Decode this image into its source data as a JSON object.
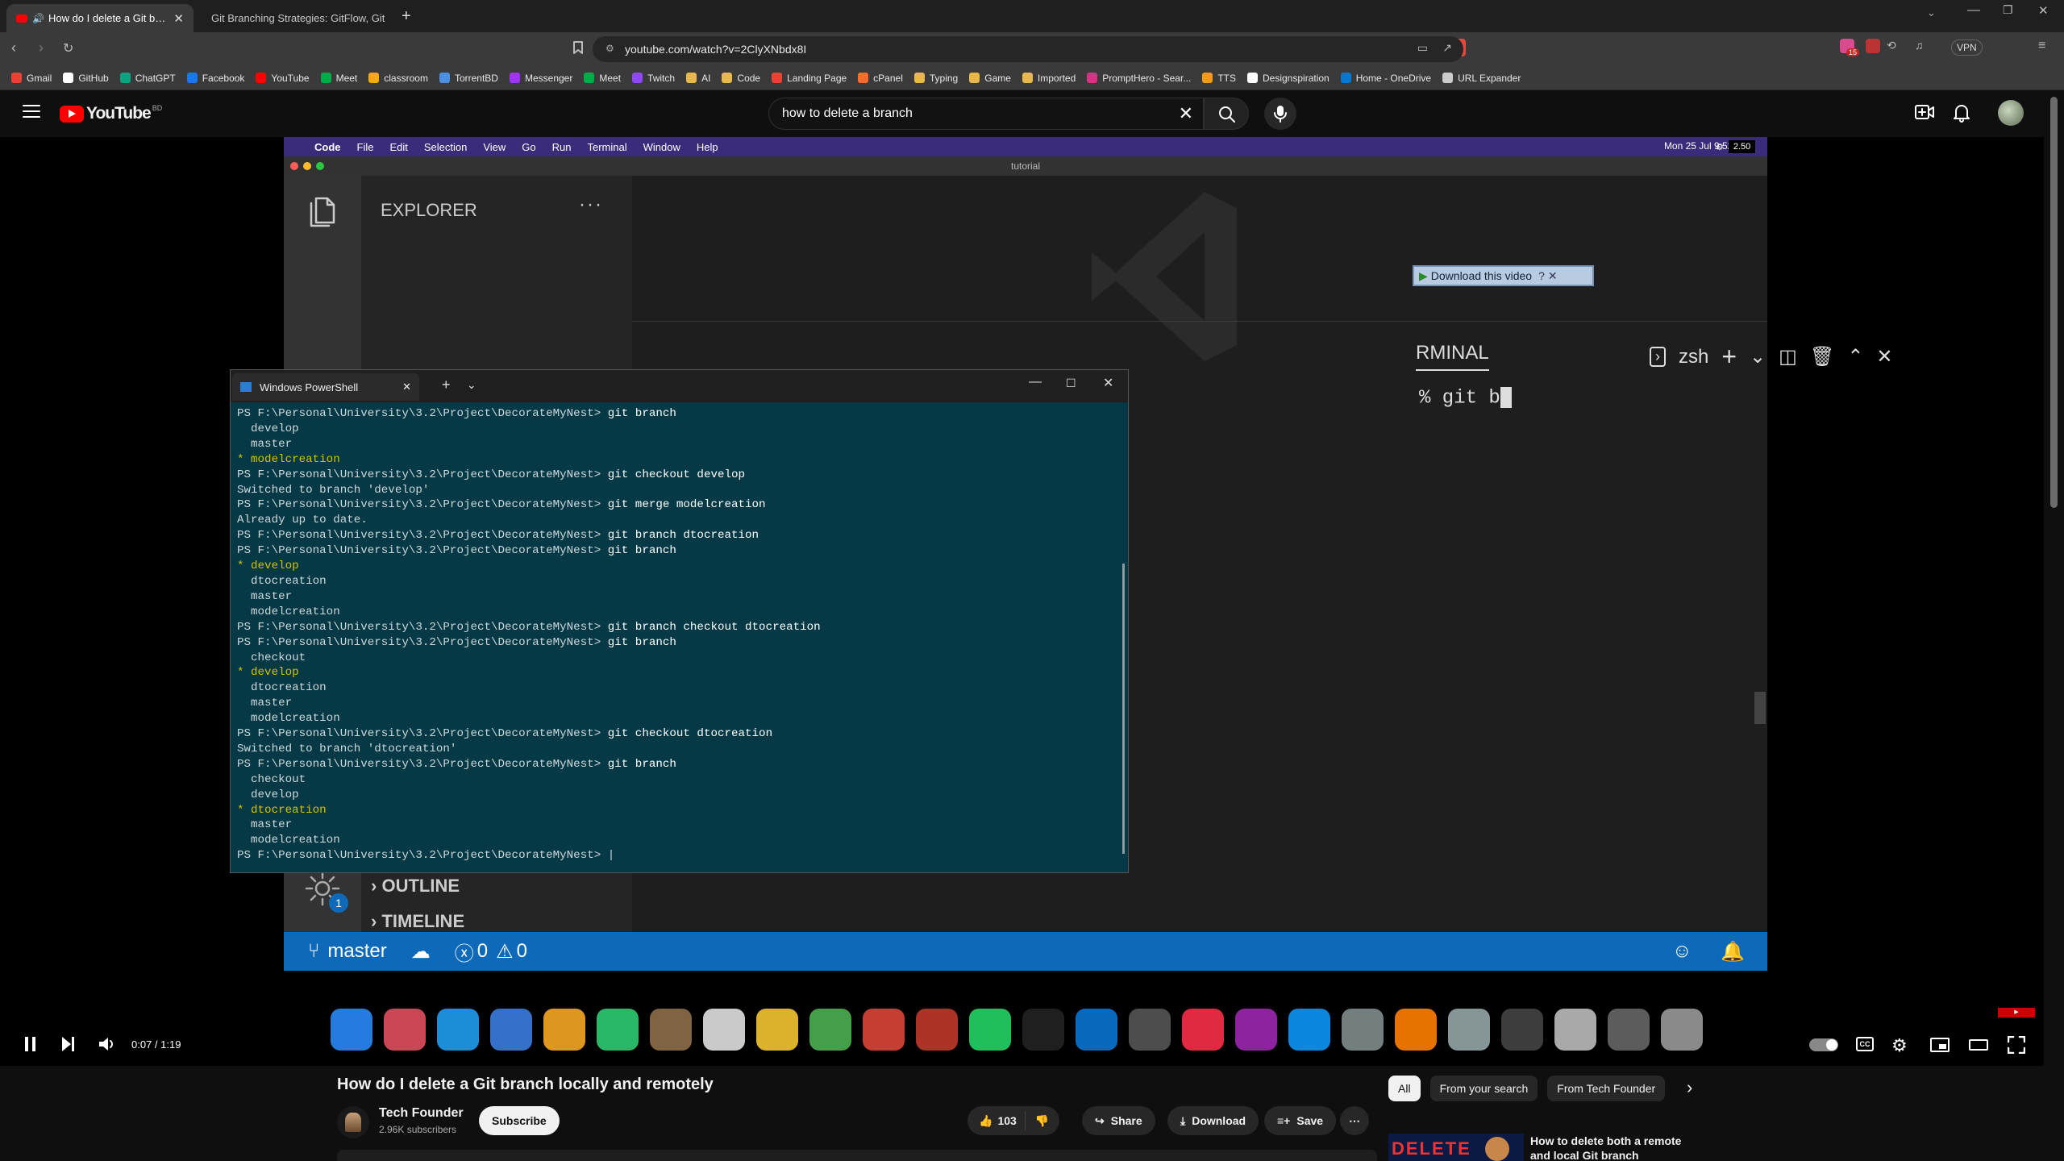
{
  "browser": {
    "tabs": [
      {
        "title": "How do I delete a Git branch"
      },
      {
        "title": "Git Branching Strategies: GitFlow, Git"
      }
    ],
    "url": "youtube.com/watch?v=2ClyXNbdx8I",
    "bookmarks": [
      {
        "label": "Gmail",
        "color": "#ea4335"
      },
      {
        "label": "GitHub",
        "color": "#ffffff"
      },
      {
        "label": "ChatGPT",
        "color": "#10a37f"
      },
      {
        "label": "Facebook",
        "color": "#1877f2"
      },
      {
        "label": "YouTube",
        "color": "#ff0000"
      },
      {
        "label": "Meet",
        "color": "#00ac47"
      },
      {
        "label": "classroom",
        "color": "#f9ab00"
      },
      {
        "label": "TorrentBD",
        "color": "#4a90e2"
      },
      {
        "label": "Messenger",
        "color": "#a033ff"
      },
      {
        "label": "Meet",
        "color": "#00ac47"
      },
      {
        "label": "Twitch",
        "color": "#9146ff"
      },
      {
        "label": "AI",
        "color": "#e8b84a"
      },
      {
        "label": "Code",
        "color": "#e8b84a"
      },
      {
        "label": "Landing Page",
        "color": "#ea4335"
      },
      {
        "label": "cPanel",
        "color": "#ff6c2c"
      },
      {
        "label": "Typing",
        "color": "#e8b84a"
      },
      {
        "label": "Game",
        "color": "#e8b84a"
      },
      {
        "label": "Imported",
        "color": "#e8b84a"
      },
      {
        "label": "PromptHero - Sear...",
        "color": "#d63384"
      },
      {
        "label": "TTS",
        "color": "#f39c12"
      },
      {
        "label": "Designspiration",
        "color": "#ffffff"
      },
      {
        "label": "Home - OneDrive",
        "color": "#0078d4"
      },
      {
        "label": "URL Expander",
        "color": "#cccccc"
      }
    ],
    "vpn_label": "VPN",
    "ext_badge": "15"
  },
  "youtube": {
    "logo_text": "YouTube",
    "logo_region": "BD",
    "search_value": "how to delete a  branch"
  },
  "mac": {
    "menubar": [
      "Code",
      "File",
      "Edit",
      "Selection",
      "View",
      "Go",
      "Run",
      "Terminal",
      "Window",
      "Help"
    ],
    "clock": "Mon 25 Jul  9:52 AM",
    "speed": "2.50",
    "window_title": "tutorial",
    "explorer_title": "EXPLORER",
    "download_video": "Download this video",
    "terminal_tab": "RMINAL",
    "shell": "zsh",
    "terminal_text": "% git b",
    "outline": "OUTLINE",
    "timeline": "TIMELINE",
    "settings_badge": "1",
    "branch": "master",
    "errors": "0",
    "warnings": "0"
  },
  "powershell": {
    "title": "Windows PowerShell",
    "lines": [
      {
        "p": "PS F:\\Personal\\University\\3.2\\Project\\DecorateMyNest> ",
        "c": "git branch",
        "t": ""
      },
      {
        "p": "",
        "c": "",
        "t": "  develop"
      },
      {
        "p": "",
        "c": "",
        "t": "  master"
      },
      {
        "p": "",
        "c": "",
        "t": "* modelcreation",
        "cur": true
      },
      {
        "p": "PS F:\\Personal\\University\\3.2\\Project\\DecorateMyNest> ",
        "c": "git checkout develop",
        "t": ""
      },
      {
        "p": "",
        "c": "",
        "t": "Switched to branch 'develop'"
      },
      {
        "p": "PS F:\\Personal\\University\\3.2\\Project\\DecorateMyNest> ",
        "c": "git merge modelcreation",
        "t": ""
      },
      {
        "p": "",
        "c": "",
        "t": "Already up to date."
      },
      {
        "p": "PS F:\\Personal\\University\\3.2\\Project\\DecorateMyNest> ",
        "c": "git branch dtocreation",
        "t": ""
      },
      {
        "p": "PS F:\\Personal\\University\\3.2\\Project\\DecorateMyNest> ",
        "c": "git branch",
        "t": ""
      },
      {
        "p": "",
        "c": "",
        "t": "* develop",
        "cur": true
      },
      {
        "p": "",
        "c": "",
        "t": "  dtocreation"
      },
      {
        "p": "",
        "c": "",
        "t": "  master"
      },
      {
        "p": "",
        "c": "",
        "t": "  modelcreation"
      },
      {
        "p": "PS F:\\Personal\\University\\3.2\\Project\\DecorateMyNest> ",
        "c": "git branch checkout dtocreation",
        "t": ""
      },
      {
        "p": "PS F:\\Personal\\University\\3.2\\Project\\DecorateMyNest> ",
        "c": "git branch",
        "t": ""
      },
      {
        "p": "",
        "c": "",
        "t": "  checkout"
      },
      {
        "p": "",
        "c": "",
        "t": "* develop",
        "cur": true
      },
      {
        "p": "",
        "c": "",
        "t": "  dtocreation"
      },
      {
        "p": "",
        "c": "",
        "t": "  master"
      },
      {
        "p": "",
        "c": "",
        "t": "  modelcreation"
      },
      {
        "p": "PS F:\\Personal\\University\\3.2\\Project\\DecorateMyNest> ",
        "c": "git checkout dtocreation",
        "t": ""
      },
      {
        "p": "",
        "c": "",
        "t": "Switched to branch 'dtocreation'"
      },
      {
        "p": "PS F:\\Personal\\University\\3.2\\Project\\DecorateMyNest> ",
        "c": "git branch",
        "t": ""
      },
      {
        "p": "",
        "c": "",
        "t": "  checkout"
      },
      {
        "p": "",
        "c": "",
        "t": "  develop"
      },
      {
        "p": "",
        "c": "",
        "t": "* dtocreation",
        "cur": true
      },
      {
        "p": "",
        "c": "",
        "t": "  master"
      },
      {
        "p": "",
        "c": "",
        "t": "  modelcreation"
      },
      {
        "p": "PS F:\\Personal\\University\\3.2\\Project\\DecorateMyNest> ",
        "c": "",
        "t": "",
        "caret": true
      }
    ]
  },
  "player": {
    "time": "0:07 / 1:19",
    "progress": 0.089
  },
  "video": {
    "title": "How do I delete a Git branch locally and remotely",
    "channel": "Tech Founder",
    "subscribers": "2.96K subscribers",
    "subscribe": "Subscribe",
    "likes": "103",
    "share": "Share",
    "download": "Download",
    "save": "Save"
  },
  "sidebar": {
    "chips": [
      "All",
      "From your search",
      "From Tech Founder"
    ],
    "rec_title": "How to delete both a remote and local Git branch",
    "rec_thumb_text": "DELETE"
  }
}
